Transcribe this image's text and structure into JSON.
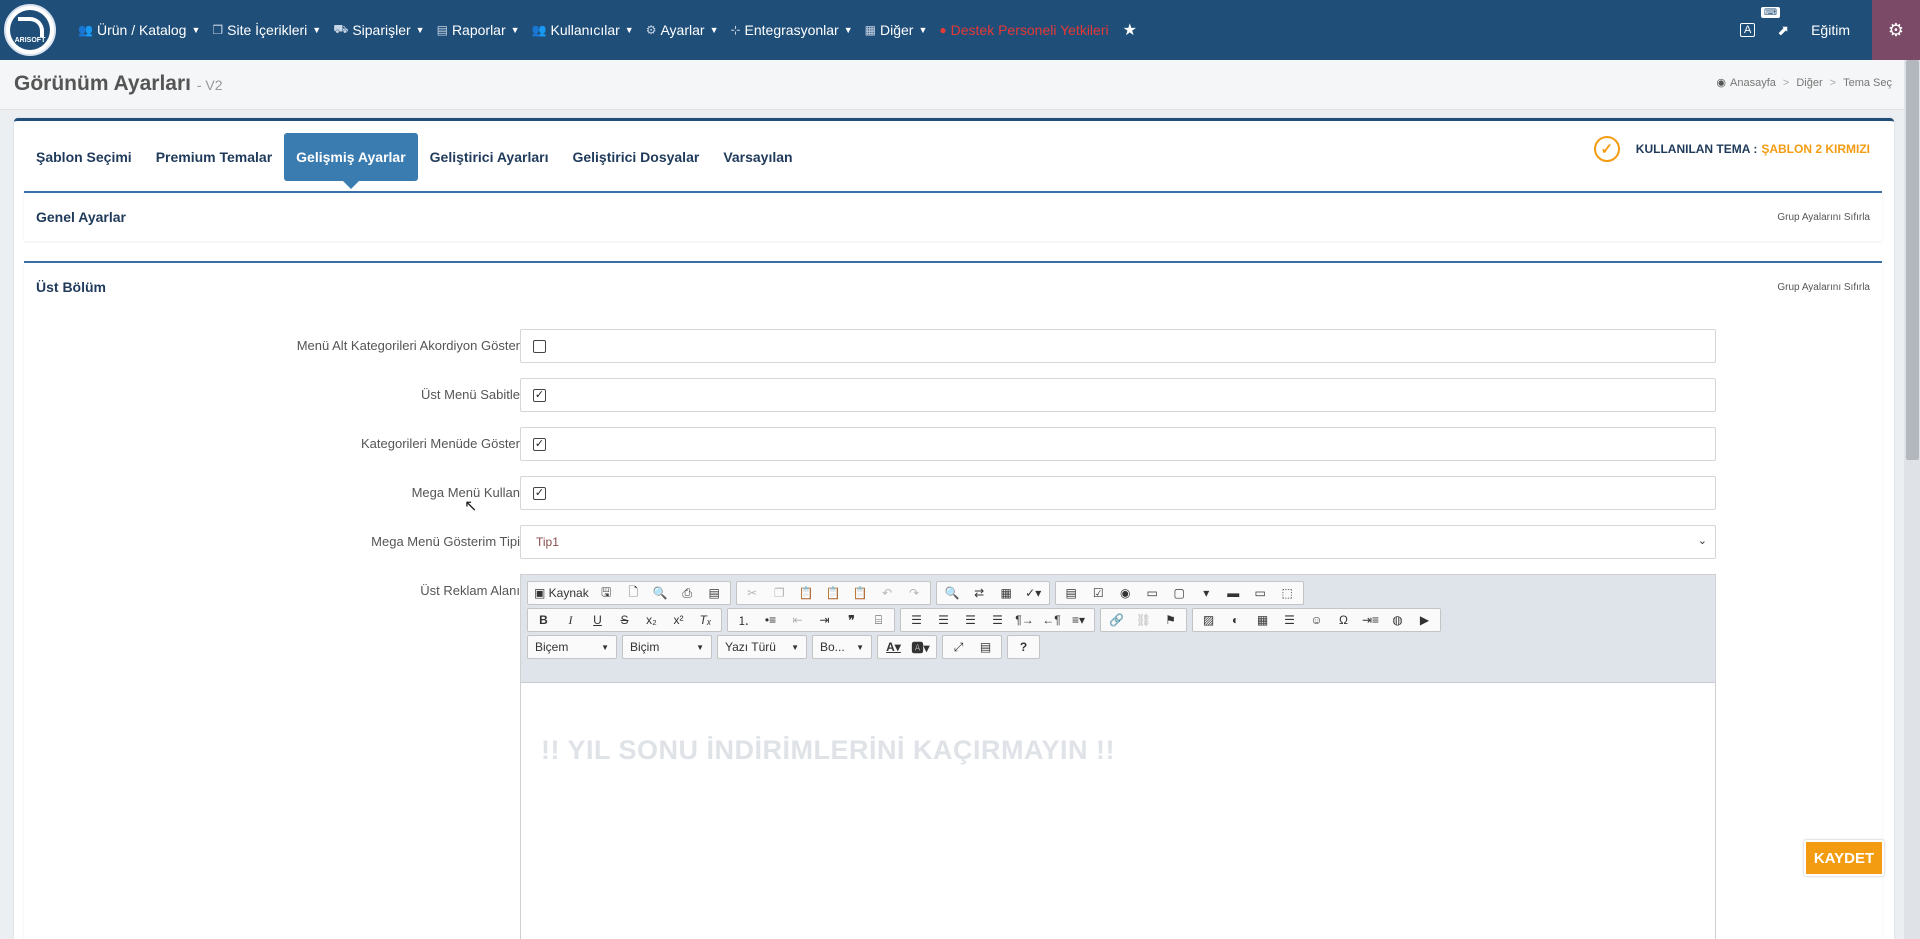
{
  "nav": {
    "logo_text": "ARISOFT",
    "items": [
      {
        "label": "Ürün / Katalog",
        "icon": "users-icon"
      },
      {
        "label": "Site İçerikleri",
        "icon": "copy-icon"
      },
      {
        "label": "Siparişler",
        "icon": "truck-icon"
      },
      {
        "label": "Raporlar",
        "icon": "report-icon"
      },
      {
        "label": "Kullanıcılar",
        "icon": "users-icon"
      },
      {
        "label": "Ayarlar",
        "icon": "gears-icon"
      },
      {
        "label": "Entegrasyonlar",
        "icon": "sitemap-icon"
      },
      {
        "label": "Diğer",
        "icon": "building-icon"
      }
    ],
    "support_label": "Destek Personeli Yetkileri",
    "user_label": "Eğitim"
  },
  "page": {
    "title": "Görünüm Ayarları",
    "version": "- V2",
    "breadcrumb": [
      "Anasayfa",
      "Diğer",
      "Tema Seç"
    ]
  },
  "tabs": [
    "Şablon Seçimi",
    "Premium Temalar",
    "Gelişmiş Ayarlar",
    "Geliştirici Ayarları",
    "Geliştirici Dosyalar",
    "Varsayılan"
  ],
  "active_tab": "Gelişmiş Ayarlar",
  "theme": {
    "label": "KULLANILAN TEMA :",
    "value": "ŞABLON 2 KIRMIZI"
  },
  "sections": {
    "general": {
      "title": "Genel Ayarlar",
      "reset": "Grup Ayalarını Sıfırla"
    },
    "top": {
      "title": "Üst Bölüm",
      "reset": "Grup Ayalarını Sıfırla"
    }
  },
  "fields": {
    "accordion": {
      "label": "Menü Alt Kategorileri Akordiyon Göster",
      "checked": false
    },
    "sticky": {
      "label": "Üst Menü Sabitle",
      "checked": true
    },
    "categories": {
      "label": "Kategorileri Menüde Göster",
      "checked": true
    },
    "mega": {
      "label": "Mega Menü Kullan",
      "checked": true
    },
    "mega_type": {
      "label": "Mega Menü Gösterim Tipi",
      "value": "Tip1"
    },
    "ad_area": {
      "label": "Üst Reklam Alanı"
    }
  },
  "editor": {
    "source_label": "Kaynak",
    "combos": [
      "Biçem",
      "Biçim",
      "Yazı Türü",
      "Bo..."
    ],
    "content": "!! YIL SONU İNDİRİMLERİNİ KAÇIRMAYIN !!"
  },
  "save_label": "KAYDET",
  "colors": {
    "navbar": "#1f4e79",
    "accent": "#f39c12",
    "tab_active": "#3a7bb0",
    "support": "#e53935"
  }
}
